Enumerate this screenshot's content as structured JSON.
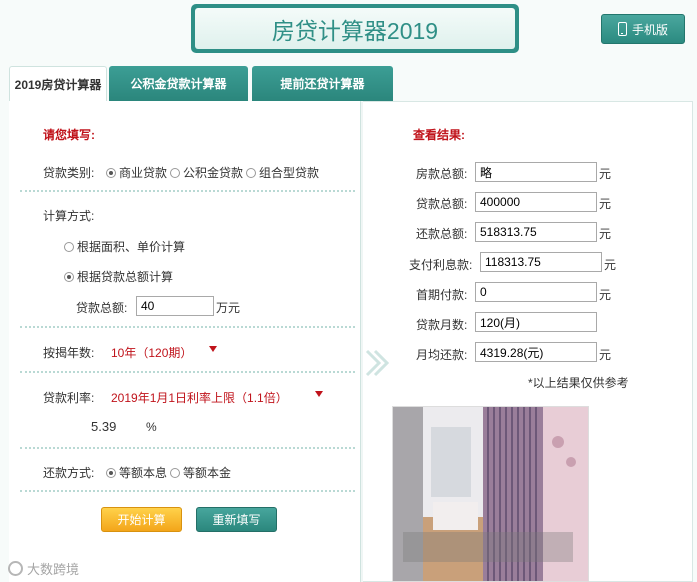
{
  "header": {
    "title": "房贷计算器2019",
    "mobile_button": "手机版"
  },
  "tabs": [
    {
      "label": "2019房贷计算器",
      "active": true
    },
    {
      "label": "公积金贷款计算器",
      "active": false
    },
    {
      "label": "提前还贷计算器",
      "active": false
    }
  ],
  "form": {
    "title": "请您填写:",
    "loan_type_label": "贷款类别:",
    "loan_type_options": [
      "商业贷款",
      "公积金贷款",
      "组合型贷款"
    ],
    "loan_type_selected": "商业贷款",
    "calc_method_label": "计算方式:",
    "calc_method_options": [
      "根据面积、单价计算",
      "根据贷款总额计算"
    ],
    "calc_method_selected": "根据贷款总额计算",
    "loan_total_label": "贷款总额:",
    "loan_total_value": "40",
    "loan_total_unit": "万元",
    "years_label": "按揭年数:",
    "years_value": "10年（120期）",
    "rate_label": "贷款利率:",
    "rate_value": "2019年1月1日利率上限（1.1倍）",
    "rate_number": "5.39",
    "rate_unit": "%",
    "repay_label": "还款方式:",
    "repay_options": [
      "等额本息",
      "等额本金"
    ],
    "repay_selected": "等额本息",
    "start_button": "开始计算",
    "reset_button": "重新填写"
  },
  "results": {
    "title": "查看结果:",
    "rows": [
      {
        "label": "房款总额:",
        "value": "略",
        "unit": "元"
      },
      {
        "label": "贷款总额:",
        "value": "400000",
        "unit": "元"
      },
      {
        "label": "还款总额:",
        "value": "518313.75",
        "unit": "元"
      },
      {
        "label": "支付利息款:",
        "value": "118313.75",
        "unit": "元"
      },
      {
        "label": "首期付款:",
        "value": "0",
        "unit": "元"
      },
      {
        "label": "贷款月数:",
        "value": "120(月)",
        "unit": ""
      },
      {
        "label": "月均还款:",
        "value": "4319.28(元)",
        "unit": "元"
      }
    ],
    "note": "*以上结果仅供参考"
  },
  "watermark": "大数跨境",
  "colors": {
    "accent": "#2e8f86",
    "red": "#c0131b",
    "orange": "#f3a51a"
  }
}
